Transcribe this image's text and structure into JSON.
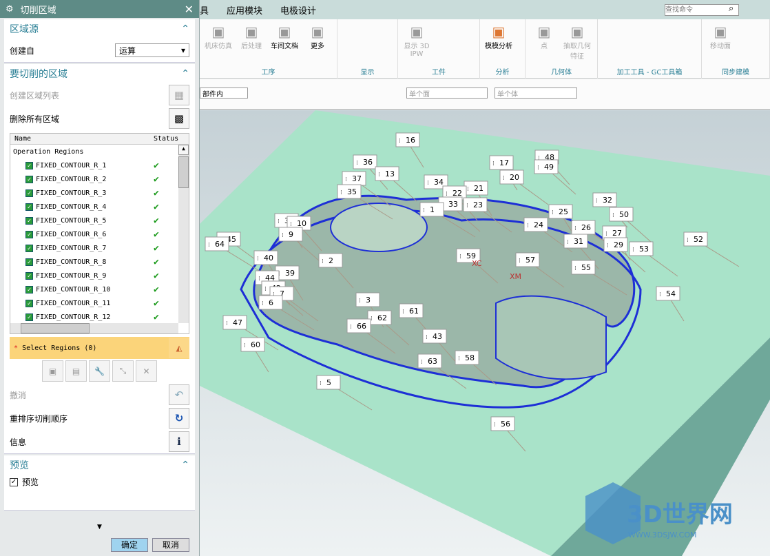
{
  "dialog": {
    "title": "切削区域",
    "close": "✕",
    "section_source": {
      "title": "区域源",
      "create_from_label": "创建自",
      "create_from_value": "运算"
    },
    "section_regions": {
      "title": "要切削的区域",
      "create_list": "创建区域列表",
      "delete_all": "删除所有区域",
      "table": {
        "headers": [
          "Name",
          "Status"
        ],
        "root": "Operation Regions",
        "rows": [
          "FIXED_CONTOUR_R_1",
          "FIXED_CONTOUR_R_2",
          "FIXED_CONTOUR_R_3",
          "FIXED_CONTOUR_R_4",
          "FIXED_CONTOUR_R_5",
          "FIXED_CONTOUR_R_6",
          "FIXED_CONTOUR_R_7",
          "FIXED_CONTOUR_R_8",
          "FIXED_CONTOUR_R_9",
          "FIXED_CONTOUR_R_10",
          "FIXED_CONTOUR_R_11",
          "FIXED_CONTOUR_R_12"
        ],
        "status": "✔"
      },
      "select_regions": "Select Regions (0)",
      "undo": "撤消",
      "reorder": "重排序切削顺序",
      "info": "信息"
    },
    "section_preview": {
      "title": "预览",
      "checkbox": "预览",
      "checked": true
    },
    "ok": "确定",
    "cancel": "取消"
  },
  "menubar": {
    "items": [
      "具",
      "应用模块",
      "电极设计"
    ],
    "search_placeholder": "查找命令"
  },
  "ribbon": {
    "groups": [
      {
        "label": "工序",
        "buttons": [
          "机床仿真",
          "后处理",
          "车间文档",
          "更多"
        ]
      },
      {
        "label": "显示",
        "buttons": []
      },
      {
        "label": "工件",
        "buttons": [
          "显示 3D IPW"
        ]
      },
      {
        "label": "分析",
        "buttons": [
          "模模分析"
        ]
      },
      {
        "label": "几何体",
        "buttons": [
          "点",
          "抽取几何特征"
        ]
      },
      {
        "label": "加工工具 - GC工具箱",
        "buttons": []
      },
      {
        "label": "同步建模",
        "buttons": [
          "移动面"
        ]
      }
    ]
  },
  "toolbar2": {
    "filter": "部件内",
    "face": "单个面",
    "body": "单个体"
  },
  "viewport": {
    "labels": [
      "16",
      "36",
      "13",
      "37",
      "35",
      "17",
      "48",
      "49",
      "20",
      "34",
      "21",
      "22",
      "33",
      "23",
      "1",
      "25",
      "32",
      "50",
      "24",
      "26",
      "27",
      "31",
      "29",
      "53",
      "52",
      "38",
      "10",
      "9",
      "45",
      "64",
      "40",
      "2",
      "59",
      "57",
      "55",
      "39",
      "44",
      "42",
      "7",
      "6",
      "3",
      "61",
      "62",
      "66",
      "47",
      "60",
      "43",
      "58",
      "63",
      "5",
      "54",
      "56"
    ],
    "axis_labels": [
      "XM",
      "XC"
    ],
    "watermark": "3D世界网",
    "watermark_url": "WWW.3DSJW.COM"
  },
  "colors": {
    "accent": "#2a7f95",
    "titlebar": "#5e8b86",
    "slab": "#a9e3c9",
    "toolpath": "#1d2fd6",
    "highlight": "#cc33cc"
  }
}
